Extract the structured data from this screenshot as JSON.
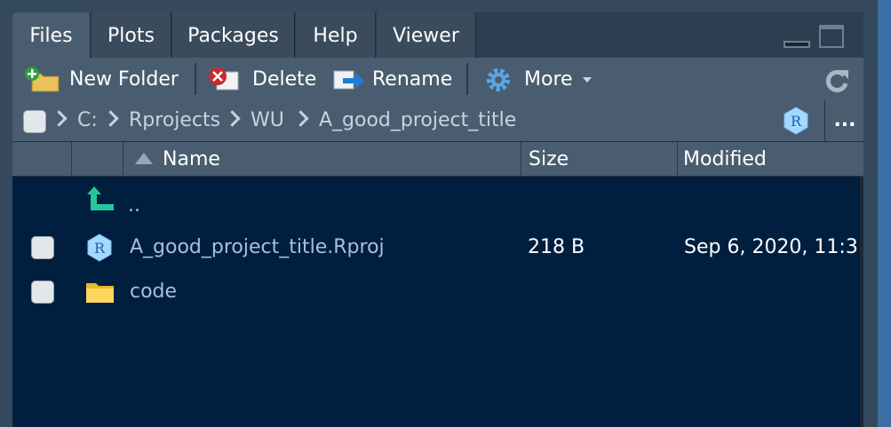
{
  "tabs": [
    {
      "label": "Files",
      "active": true
    },
    {
      "label": "Plots",
      "active": false
    },
    {
      "label": "Packages",
      "active": false
    },
    {
      "label": "Help",
      "active": false
    },
    {
      "label": "Viewer",
      "active": false
    }
  ],
  "toolbar": {
    "new_folder": "New Folder",
    "delete": "Delete",
    "rename": "Rename",
    "more": "More"
  },
  "path": {
    "segments": [
      "C:",
      "Rprojects",
      "WU",
      "A_good_project_title"
    ],
    "more": "..."
  },
  "table": {
    "headers": {
      "name": "Name",
      "size": "Size",
      "modified": "Modified"
    },
    "parent": "..",
    "rows": [
      {
        "name": "A_good_project_title.Rproj",
        "size": "218 B",
        "modified": "Sep 6, 2020, 11:3",
        "icon": "rproj-file-icon"
      },
      {
        "name": "code",
        "size": "",
        "modified": "",
        "icon": "folder-icon"
      }
    ]
  },
  "colors": {
    "accent": "#3a5068",
    "list_bg": "#001f3f",
    "file_link": "#a6bfdc",
    "toolbar_bg": "#4a5d70"
  }
}
